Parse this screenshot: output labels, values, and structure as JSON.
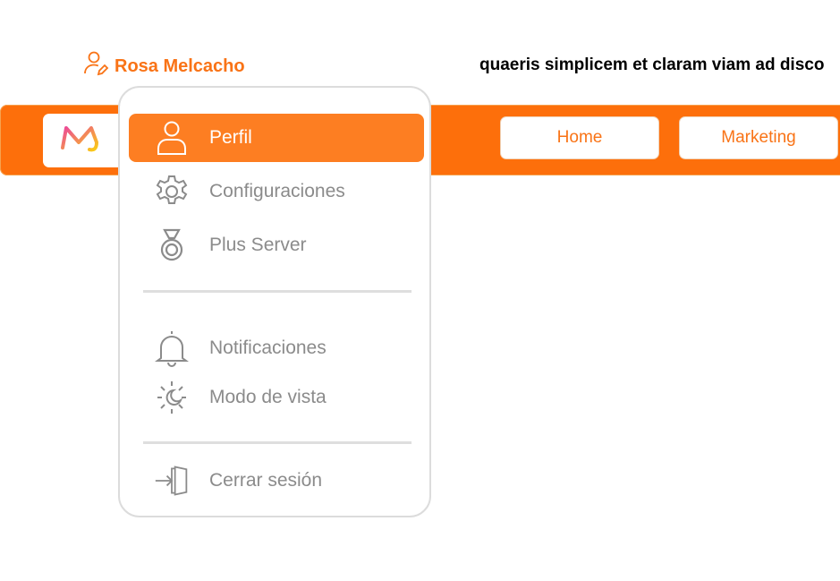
{
  "header": {
    "user_name": "Rosa Melcacho",
    "tagline": "quaeris simplicem et claram viam ad disco"
  },
  "nav": {
    "buttons": [
      {
        "label": "Home"
      },
      {
        "label": "Marketing"
      }
    ]
  },
  "menu": {
    "items": [
      {
        "label": "Perfil",
        "icon": "user-icon",
        "active": true
      },
      {
        "label": "Configuraciones",
        "icon": "gear-icon"
      },
      {
        "label": "Plus Server",
        "icon": "medal-icon"
      },
      {
        "label": "Notificaciones",
        "icon": "bell-icon"
      },
      {
        "label": "Modo de vista",
        "icon": "sun-moon-icon"
      },
      {
        "label": "Cerrar sesión",
        "icon": "logout-door-icon"
      }
    ]
  },
  "colors": {
    "accent": "#fd6f0b",
    "active_item": "#fd7e22",
    "menu_text": "#8b8b8b"
  }
}
